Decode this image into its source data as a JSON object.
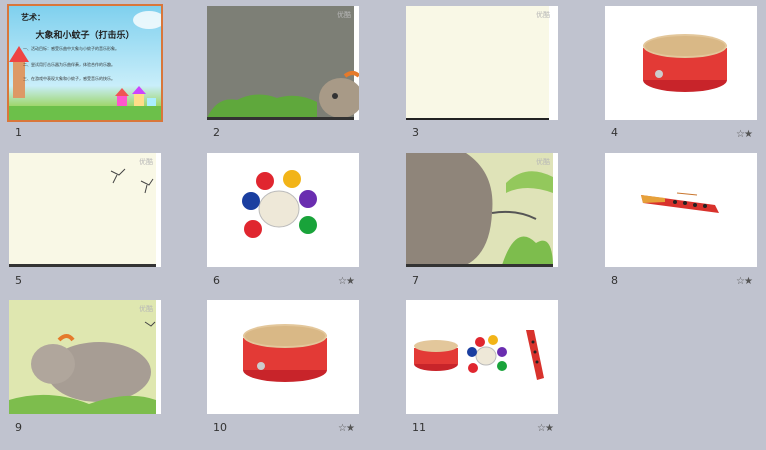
{
  "slides": [
    {
      "number": "1",
      "title": "艺术：",
      "subtitle": "大象和小蚊子（打击乐）",
      "lines": [
        "一、活动目标：感受乐曲中大象与小蚊子的音乐形象。",
        "二、尝试用打击乐器为乐曲伴奏，体验合作的乐趣。",
        "三、在游戏中表现大象和小蚊子，感受音乐的快乐。"
      ]
    },
    {
      "number": "2",
      "watermark": "优酷"
    },
    {
      "number": "3",
      "watermark": "优酷"
    },
    {
      "number": "4",
      "star": "☆★"
    },
    {
      "number": "5",
      "watermark": "优酷"
    },
    {
      "number": "6",
      "star": "☆★"
    },
    {
      "number": "7",
      "watermark": "优酷"
    },
    {
      "number": "8",
      "star": "☆★"
    },
    {
      "number": "9",
      "watermark": "优酷"
    },
    {
      "number": "10",
      "star": "☆★"
    },
    {
      "number": "11",
      "star": "☆★"
    }
  ]
}
